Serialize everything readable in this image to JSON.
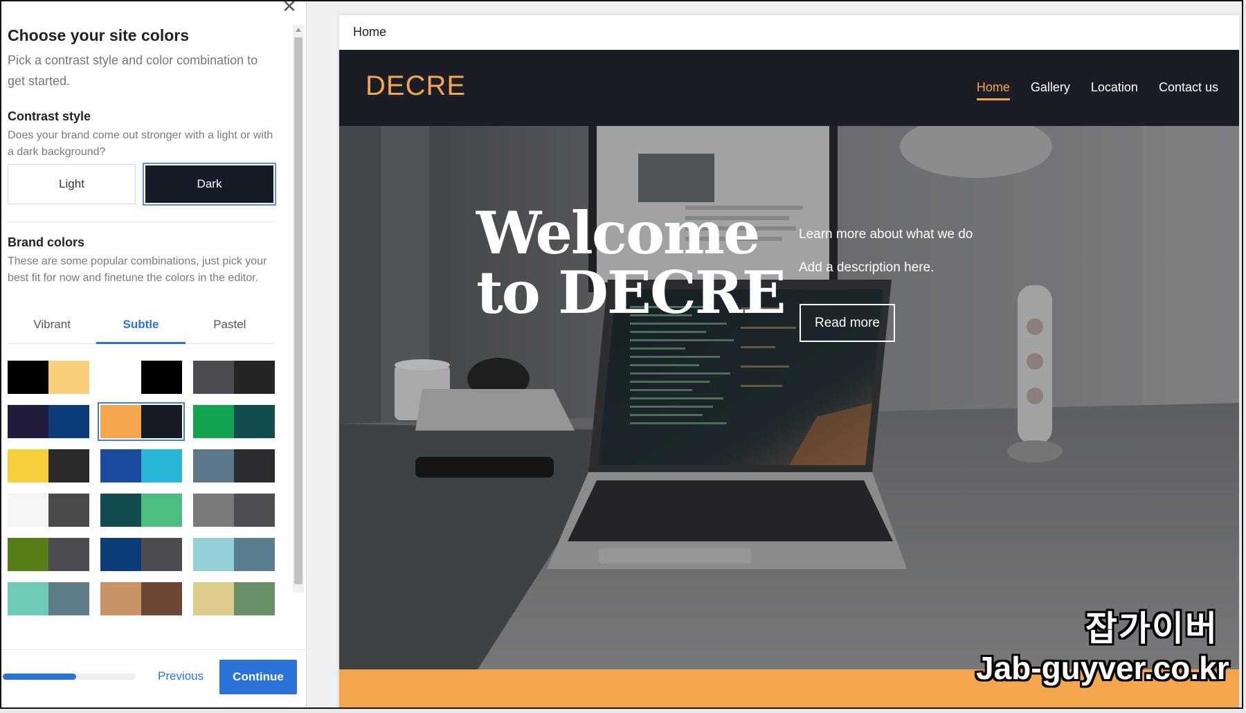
{
  "panel": {
    "close_icon": "close-icon",
    "title": "Choose your site colors",
    "subtitle": "Pick a contrast style and color combination to get started.",
    "contrast": {
      "title": "Contrast style",
      "description": "Does your brand come out stronger with a light or with a dark background?",
      "light_label": "Light",
      "dark_label": "Dark",
      "selected": "Dark"
    },
    "brand": {
      "title": "Brand colors",
      "description": "These are some popular combinations, just pick your best fit for now and finetune the colors in the editor.",
      "tabs": [
        "Vibrant",
        "Subtle",
        "Pastel"
      ],
      "active_tab": "Subtle",
      "swatches": [
        [
          "#000000",
          "#f9cf7c"
        ],
        [
          "#ffffff",
          "#000000"
        ],
        [
          "#4b4c51",
          "#252525"
        ],
        [
          "#221c3b",
          "#0d3c7a"
        ],
        [
          "#f3a64b",
          "#151a24"
        ],
        [
          "#14a34f",
          "#134c4f"
        ],
        [
          "#f7cf3a",
          "#2a2a2a"
        ],
        [
          "#1b4b9f",
          "#25b6d8"
        ],
        [
          "#5d7a8a",
          "#2b2c30"
        ],
        [
          "#f5f5f5",
          "#4a4a4a"
        ],
        [
          "#134c4f",
          "#4dbd80"
        ],
        [
          "#7a7a7d",
          "#4d4d52"
        ],
        [
          "#567d18",
          "#4c4d52"
        ],
        [
          "#0d3c7a",
          "#4c4d52"
        ],
        [
          "#95d0d7",
          "#5a7d8f"
        ],
        [
          "#6ecbb8",
          "#5f7c89"
        ],
        [
          "#c79367",
          "#6e4635"
        ],
        [
          "#dbcc8c",
          "#6a9068"
        ],
        [
          "#f2f2f2",
          "#c9cde0"
        ],
        [
          "#eee7dc",
          "#c4c2ca"
        ],
        [
          "#cfe6cb",
          "#b4b4b4"
        ]
      ],
      "selected_index": 4
    },
    "footer": {
      "progress": 0.55,
      "previous_label": "Previous",
      "continue_label": "Continue"
    }
  },
  "preview": {
    "page_label": "Home",
    "logo": "DECRE",
    "menu": [
      "Home",
      "Gallery",
      "Location",
      "Contact us"
    ],
    "active_menu": "Home",
    "hero": {
      "heading_line1": "Welcome",
      "heading_line2": "to DECRE",
      "learn_more": "Learn more about what we do",
      "description": "Add a description here.",
      "button": "Read more"
    },
    "accent_color": "#f3a64b",
    "nav_bg": "#1a1d25"
  },
  "watermark": {
    "line1": "잡가이버",
    "line2": "Jab-guyver.co.kr"
  }
}
